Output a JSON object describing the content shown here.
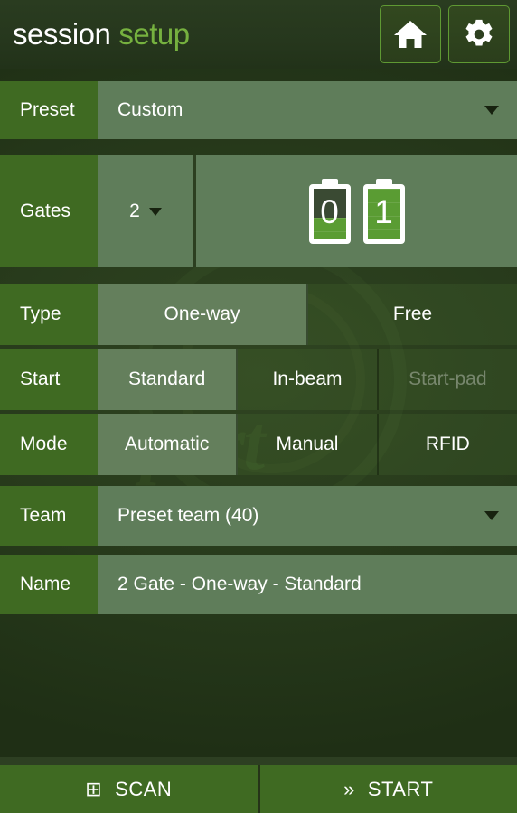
{
  "header": {
    "title_part1": "session",
    "title_part2": "setup",
    "home_button_label": "Home",
    "settings_button_label": "Settings",
    "home_icon": "home-icon",
    "settings_icon": "gear-icon"
  },
  "background": {
    "watermark_text": "nuTsport"
  },
  "colors": {
    "label_green": "#3f6a22",
    "field_green": "#5f7d5a",
    "selected_green": "#647f5c",
    "accent_green": "#76b13f",
    "battery_fill": "#5a9c33",
    "page_bg": "#273a1b"
  },
  "rows": {
    "preset": {
      "label": "Preset",
      "value": "Custom",
      "caret": "chevron-down-icon"
    },
    "gates": {
      "label": "Gates",
      "count": "2",
      "caret": "chevron-down-icon",
      "batteries": [
        {
          "id": "0",
          "level_percent": 42
        },
        {
          "id": "1",
          "level_percent": 100
        }
      ]
    },
    "type": {
      "label": "Type",
      "options": [
        {
          "label": "One-way",
          "selected": true,
          "disabled": false
        },
        {
          "label": "Free",
          "selected": false,
          "disabled": false
        }
      ]
    },
    "start": {
      "label": "Start",
      "options": [
        {
          "label": "Standard",
          "selected": true,
          "disabled": false
        },
        {
          "label": "In-beam",
          "selected": false,
          "disabled": false
        },
        {
          "label": "Start-pad",
          "selected": false,
          "disabled": true
        }
      ]
    },
    "mode": {
      "label": "Mode",
      "options": [
        {
          "label": "Automatic",
          "selected": true,
          "disabled": false
        },
        {
          "label": "Manual",
          "selected": false,
          "disabled": false
        },
        {
          "label": "RFID",
          "selected": false,
          "disabled": false
        }
      ]
    },
    "team": {
      "label": "Team",
      "value": "Preset team (40)",
      "caret": "chevron-down-icon"
    },
    "name": {
      "label": "Name",
      "value": "2 Gate - One-way - Standard"
    }
  },
  "bottom_bar": {
    "scan": {
      "label": "SCAN",
      "icon": "grid-plus-icon",
      "glyph": "⊞"
    },
    "start": {
      "label": "START",
      "icon": "double-chevron-right-icon",
      "glyph": "»"
    }
  }
}
